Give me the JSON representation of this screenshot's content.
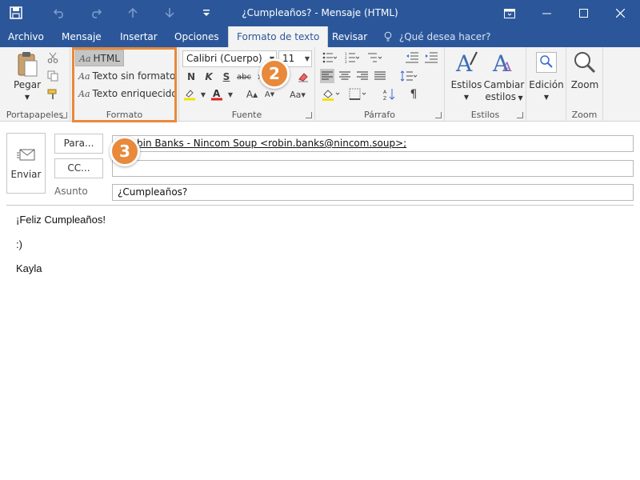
{
  "window": {
    "title": "¿Cumpleaños? - Mensaje (HTML)",
    "titlebar_color": "#2b579a",
    "accent_color": "#e8893b"
  },
  "tabs": [
    {
      "label": "Archivo"
    },
    {
      "label": "Mensaje"
    },
    {
      "label": "Insertar"
    },
    {
      "label": "Opciones"
    },
    {
      "label": "Formato de texto",
      "active": true
    },
    {
      "label": "Revisar"
    }
  ],
  "tell_me": "¿Qué desea hacer?",
  "ribbon": {
    "clipboard": {
      "label": "Portapapeles",
      "paste_label": "Pegar"
    },
    "format": {
      "label": "Formato",
      "options": [
        "HTML",
        "Texto sin formato",
        "Texto enriquecido"
      ],
      "selected": "HTML",
      "aa": "Aa"
    },
    "font": {
      "label": "Fuente",
      "family": "Calibri (Cuerpo)",
      "size": "11"
    },
    "paragraph": {
      "label": "Párrafo"
    },
    "styles": {
      "label": "Estilos",
      "styles_label": "Estilos",
      "change_label": "Cambiar",
      "change_label2": "estilos"
    },
    "editing": {
      "label": "Edición"
    },
    "zoom": {
      "label": "Zoom",
      "zoom_label": "Zoom"
    }
  },
  "callouts": {
    "step2": "2",
    "step3": "3"
  },
  "compose": {
    "send_label": "Enviar",
    "to_button": "Para...",
    "cc_button": "CC...",
    "subject_label": "Asunto",
    "to_value": "Robin Banks - Nincom Soup <robin.banks@nincom.soup>;",
    "to_visible": "bin Banks - Nincom Soup <robin.banks@nincom.soup>;",
    "cc_value": "",
    "subject_value": "¿Cumpleaños?"
  },
  "body": {
    "lines": [
      "¡Feliz Cumpleaños!",
      ":)",
      "Kayla"
    ]
  }
}
